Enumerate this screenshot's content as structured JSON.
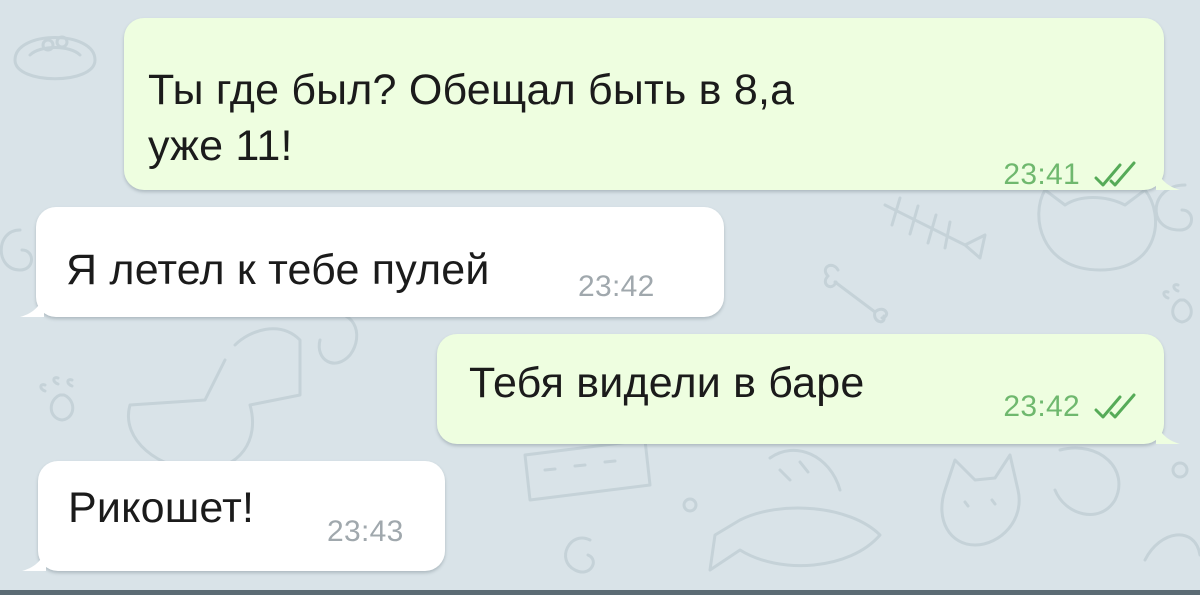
{
  "theme": {
    "background": "#d9e3e8",
    "doodle_color": "#c5d2d8",
    "outgoing_bubble": "#eefee0",
    "incoming_bubble": "#ffffff",
    "outgoing_time_color": "#6fb86e",
    "incoming_time_color": "#a0a8ad",
    "read_tick_color": "#56ab58"
  },
  "messages": [
    {
      "direction": "outgoing",
      "text": "Ты где был? Обещал быть в 8,а\nуже 11!",
      "time": "23:41",
      "status_icon": "double-check-icon"
    },
    {
      "direction": "incoming",
      "text": "Я летел к тебе пулей",
      "time": "23:42"
    },
    {
      "direction": "outgoing",
      "text": "Тебя видели в баре",
      "time": "23:42",
      "status_icon": "double-check-icon"
    },
    {
      "direction": "incoming",
      "text": "Рикошет!",
      "time": "23:43"
    }
  ]
}
